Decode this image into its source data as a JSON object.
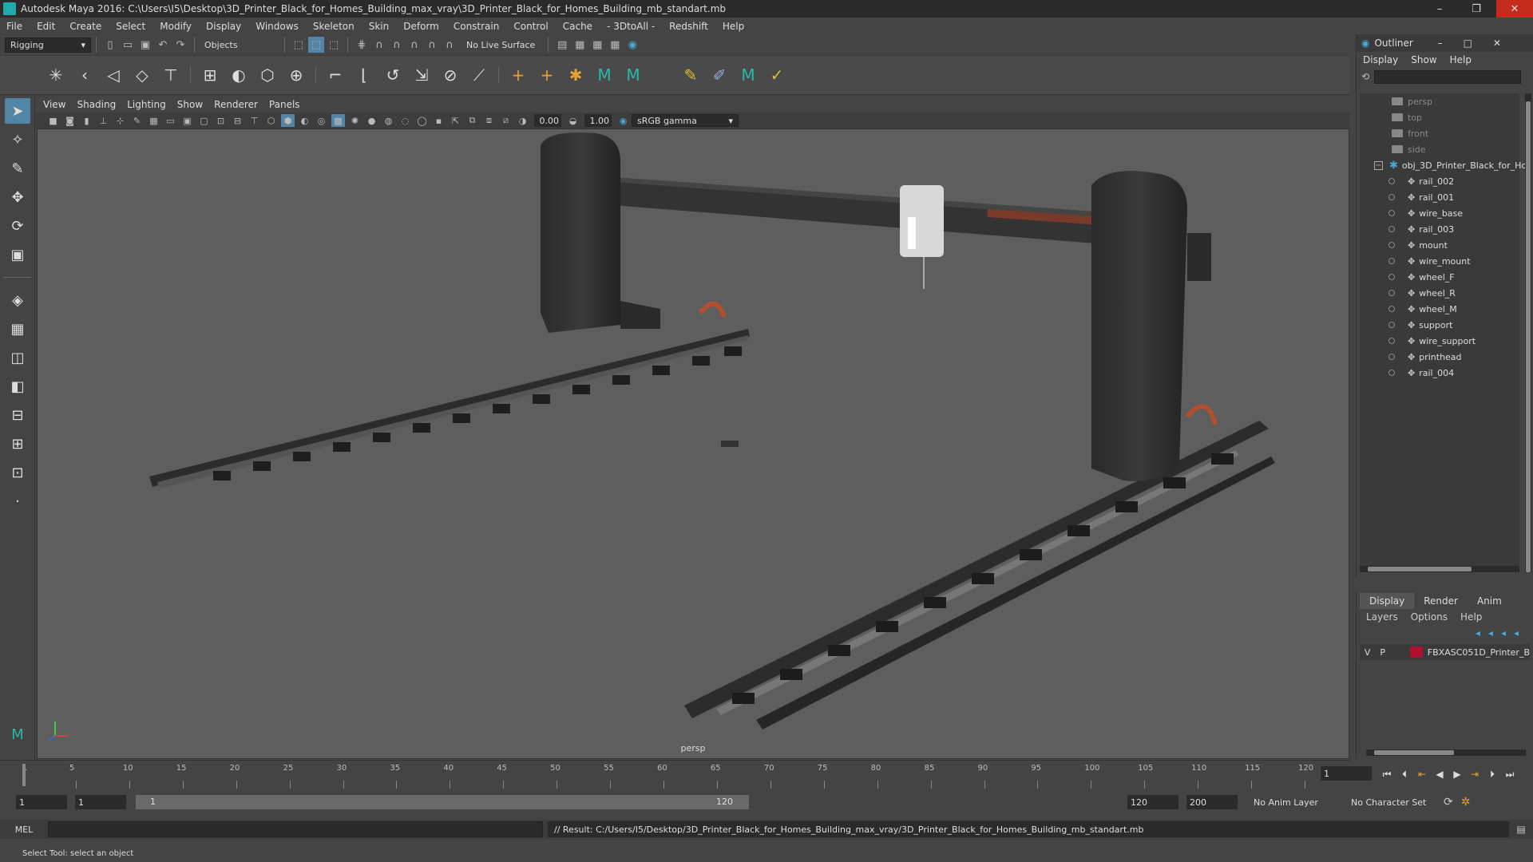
{
  "window": {
    "title": "Autodesk Maya 2016: C:\\Users\\I5\\Desktop\\3D_Printer_Black_for_Homes_Building_max_vray\\3D_Printer_Black_for_Homes_Building_mb_standart.mb",
    "minimize": "–",
    "maximize": "❐",
    "close": "✕"
  },
  "menubar": [
    "File",
    "Edit",
    "Create",
    "Select",
    "Modify",
    "Display",
    "Windows",
    "Skeleton",
    "Skin",
    "Deform",
    "Constrain",
    "Control",
    "Cache",
    "- 3DtoAll -",
    "Redshift",
    "Help"
  ],
  "statusline": {
    "mode": "Rigging",
    "selection_mode": "Objects",
    "live_surface": "No Live Surface"
  },
  "viewport": {
    "menu": [
      "View",
      "Shading",
      "Lighting",
      "Show",
      "Renderer",
      "Panels"
    ],
    "exposure": "0.00",
    "gamma": "1.00",
    "color_space": "sRGB gamma",
    "camera_label": "persp"
  },
  "outliner": {
    "title": "Outliner",
    "menu": [
      "Display",
      "Show",
      "Help"
    ],
    "cameras": [
      "persp",
      "top",
      "front",
      "side"
    ],
    "group": "obj_3D_Printer_Black_for_Ho",
    "children": [
      "rail_002",
      "rail_001",
      "wire_base",
      "rail_003",
      "mount",
      "wire_mount",
      "wheel_F",
      "wheel_R",
      "wheel_M",
      "support",
      "wire_support",
      "printhead",
      "rail_004"
    ]
  },
  "channel": {
    "tabs": [
      "Display",
      "Render",
      "Anim"
    ],
    "menu": [
      "Layers",
      "Options",
      "Help"
    ],
    "layer": {
      "v": "V",
      "p": "P",
      "name": "FBXASC051D_Printer_B",
      "color": "#b01030"
    }
  },
  "timeline": {
    "ticks": [
      "5",
      "10",
      "15",
      "20",
      "25",
      "30",
      "35",
      "40",
      "45",
      "50",
      "55",
      "60",
      "65",
      "70",
      "75",
      "80",
      "85",
      "90",
      "95",
      "100",
      "105",
      "110",
      "115",
      "120"
    ],
    "current_frame": "1",
    "playhead_label": "1",
    "start_frame": "1",
    "playback_start": "1",
    "range_start_label": "1",
    "range_end_label": "120",
    "playback_end": "120",
    "end_frame": "200",
    "anim_layer": "No Anim Layer",
    "character_set": "No Character Set"
  },
  "cmdline": {
    "language": "MEL",
    "result": "// Result: C:/Users/I5/Desktop/3D_Printer_Black_for_Homes_Building_max_vray/3D_Printer_Black_for_Homes_Building_mb_standart.mb"
  },
  "helpline": "Select Tool: select an object"
}
